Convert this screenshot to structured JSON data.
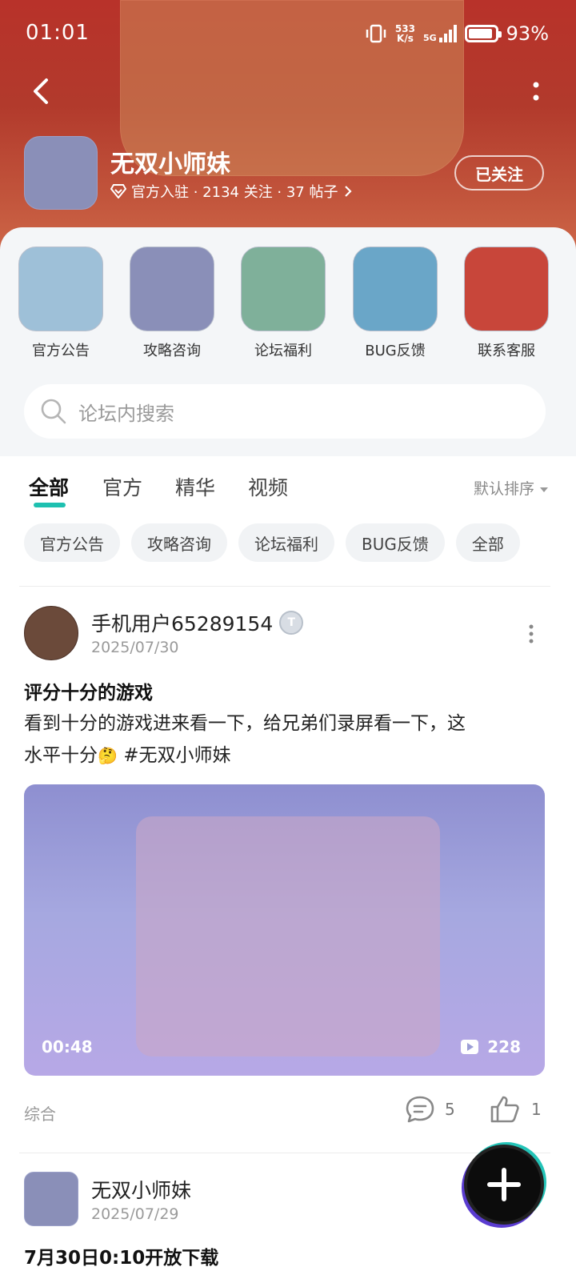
{
  "status_bar": {
    "time": "01:01",
    "speed_value": "533",
    "speed_unit": "K/s",
    "network": "5G",
    "battery": "93%"
  },
  "header": {
    "forum_name": "无双小师妹",
    "meta": "官方入驻 · 2134 关注 · 37 帖子",
    "follow_label": "已关注"
  },
  "quick_nav": [
    {
      "label": "官方公告"
    },
    {
      "label": "攻略咨询"
    },
    {
      "label": "论坛福利"
    },
    {
      "label": "BUG反馈"
    },
    {
      "label": "联系客服"
    }
  ],
  "search": {
    "placeholder": "论坛内搜索"
  },
  "tabs": [
    {
      "label": "全部"
    },
    {
      "label": "官方"
    },
    {
      "label": "精华"
    },
    {
      "label": "视频"
    }
  ],
  "sort_label": "默认排序",
  "chips": [
    {
      "label": "官方公告"
    },
    {
      "label": "攻略咨询"
    },
    {
      "label": "论坛福利"
    },
    {
      "label": "BUG反馈"
    },
    {
      "label": "全部"
    }
  ],
  "posts": [
    {
      "author": "手机用户65289154",
      "level": "T",
      "date": "2025/07/30",
      "title": "评分十分的游戏",
      "body_line1": "看到十分的游戏进来看一下，给兄弟们录屏看一下，这",
      "body_line2": "水平十分",
      "body_emoji": "🤔",
      "body_tag": " #无双小师妹",
      "video_duration": "00:48",
      "video_plays": "228",
      "category": "综合",
      "comments": "5",
      "likes": "1"
    },
    {
      "author": "无双小师妹",
      "date": "2025/07/29",
      "title": "7月30日0:10开放下载"
    }
  ],
  "colors": {
    "header_red": "#b8322a",
    "tab_accent": "#1ec0b0"
  }
}
